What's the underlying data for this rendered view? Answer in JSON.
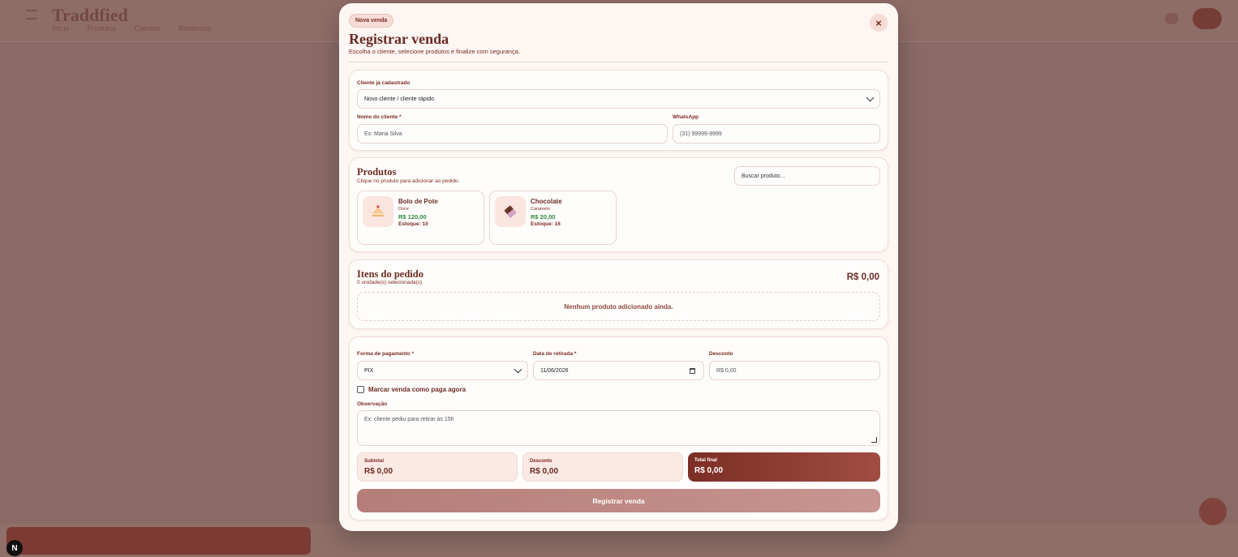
{
  "background": {
    "logo": "Traddfied",
    "nav": [
      "Início",
      "Produtos",
      "Clientes",
      "Relatórios"
    ]
  },
  "modal": {
    "badge": "Nova venda",
    "title": "Registrar venda",
    "subtitle": "Escolha o cliente, selecione produtos e finalize com segurança.",
    "close_label": "×"
  },
  "client": {
    "existing_label": "Cliente já cadastrado",
    "existing_value": "Novo cliente / cliente rápido",
    "name_label": "Nome do cliente *",
    "name_placeholder": "Ex: Maria Silva",
    "whatsapp_label": "WhatsApp",
    "whatsapp_placeholder": "(31) 99999-9999"
  },
  "products": {
    "title": "Produtos",
    "subtitle": "Clique no produto para adicionar ao pedido.",
    "search_placeholder": "Buscar produto...",
    "items": [
      {
        "name": "Bolo de Pote",
        "category": "Doce",
        "price": "R$ 120,00",
        "stock": "Estoque: 10",
        "icon": "cake-icon"
      },
      {
        "name": "Chocolate",
        "category": "Caramelo",
        "price": "R$ 20,00",
        "stock": "Estoque: 16",
        "icon": "chocolate-icon"
      }
    ]
  },
  "order": {
    "title": "Itens do pedido",
    "subtitle": "0 unidade(s) selecionada(s).",
    "total": "R$ 0,00",
    "empty": "Nenhum produto adicionado ainda."
  },
  "payment": {
    "method_label": "Forma de pagamento *",
    "method_value": "PIX",
    "date_label": "Data de retirada *",
    "date_value": "11/06/2026",
    "discount_label": "Desconto",
    "discount_placeholder": "R$ 0,00",
    "paid_label": "Marcar venda como paga agora",
    "note_label": "Observação",
    "note_placeholder": "Ex: cliente pediu para retirar às 15h"
  },
  "summary": {
    "subtotal_label": "Subtotal",
    "subtotal_value": "R$ 0,00",
    "discount_label": "Desconto",
    "discount_value": "R$ 0,00",
    "total_label": "Total final",
    "total_value": "R$ 0,00"
  },
  "submit_label": "Registrar venda",
  "colors": {
    "primary": "#6b2a22",
    "price": "#2e8b3d",
    "modal_bg": "#fdf6f3"
  }
}
